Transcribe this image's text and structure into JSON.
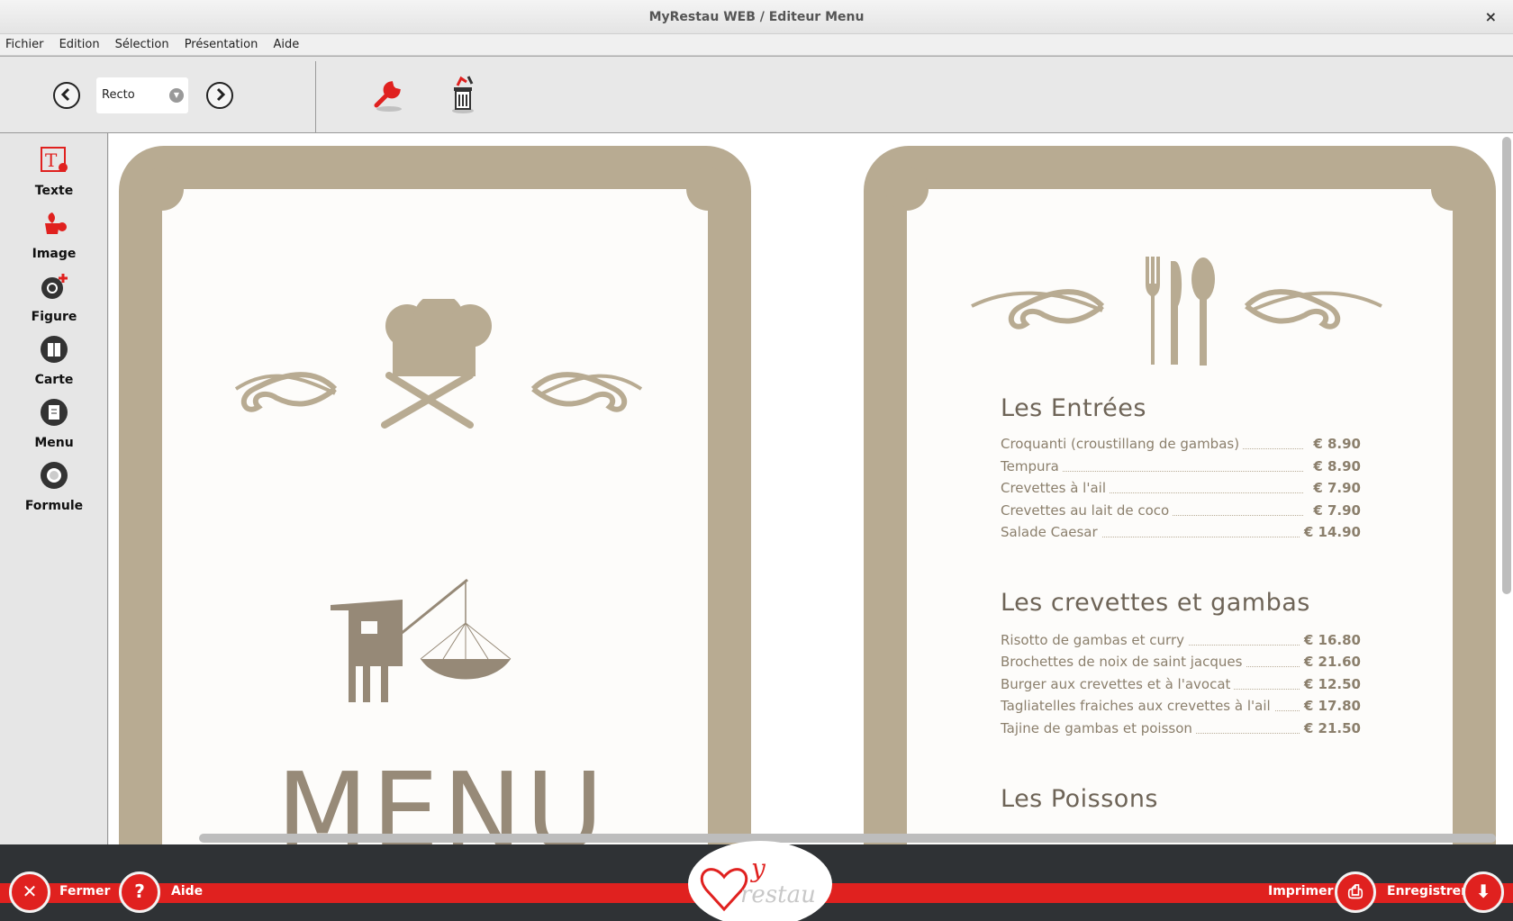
{
  "window": {
    "title": "MyRestau WEB / Editeur Menu",
    "close_glyph": "×"
  },
  "menubar": {
    "items": [
      "Fichier",
      "Edition",
      "Sélection",
      "Présentation",
      "Aide"
    ]
  },
  "toolbar": {
    "prev_icon": "chevron-left-icon",
    "next_icon": "chevron-right-icon",
    "page_select_value": "Recto",
    "tools_icon": "wrench-icon",
    "delete_icon": "trash-icon"
  },
  "palette": {
    "items": [
      {
        "label": "Texte",
        "icon": "text-add-icon"
      },
      {
        "label": "Image",
        "icon": "image-add-icon"
      },
      {
        "label": "Figure",
        "icon": "figure-add-icon"
      },
      {
        "label": "Carte",
        "icon": "card-icon"
      },
      {
        "label": "Menu",
        "icon": "menu-book-icon"
      },
      {
        "label": "Formule",
        "icon": "plate-icon"
      }
    ]
  },
  "front_page": {
    "big_title": "MENU"
  },
  "back_page": {
    "sections": [
      {
        "title": "Les Entrées",
        "items": [
          {
            "name": "Croquanti (croustillang de gambas)",
            "price": "€   8.90"
          },
          {
            "name": "Tempura",
            "price": "€   8.90"
          },
          {
            "name": "Crevettes à l'ail",
            "price": "€   7.90"
          },
          {
            "name": "Crevettes au lait de coco",
            "price": "€   7.90"
          },
          {
            "name": "Salade Caesar",
            "price": "€ 14.90"
          }
        ]
      },
      {
        "title": "Les crevettes et gambas",
        "items": [
          {
            "name": "Risotto de gambas et curry",
            "price": "€ 16.80"
          },
          {
            "name": "Brochettes de noix de saint jacques",
            "price": "€ 21.60"
          },
          {
            "name": "Burger aux crevettes et à l'avocat",
            "price": "€ 12.50"
          },
          {
            "name": "Tagliatelles fraiches aux crevettes à l'ail",
            "price": "€ 17.80"
          },
          {
            "name": "Tajine de gambas et poisson",
            "price": "€ 21.50"
          }
        ]
      },
      {
        "title": "Les Poissons",
        "items": []
      }
    ]
  },
  "bottombar": {
    "close_label": "Fermer",
    "help_label": "Aide",
    "print_label": "Imprimer",
    "save_label": "Enregistrer",
    "logo_text_my": "y",
    "logo_text_restau": "restau"
  },
  "colors": {
    "accent": "#e0211f",
    "frame": "#b8ab92",
    "text_muted": "#8b7f6c",
    "bottom_bg": "#2f3235"
  }
}
